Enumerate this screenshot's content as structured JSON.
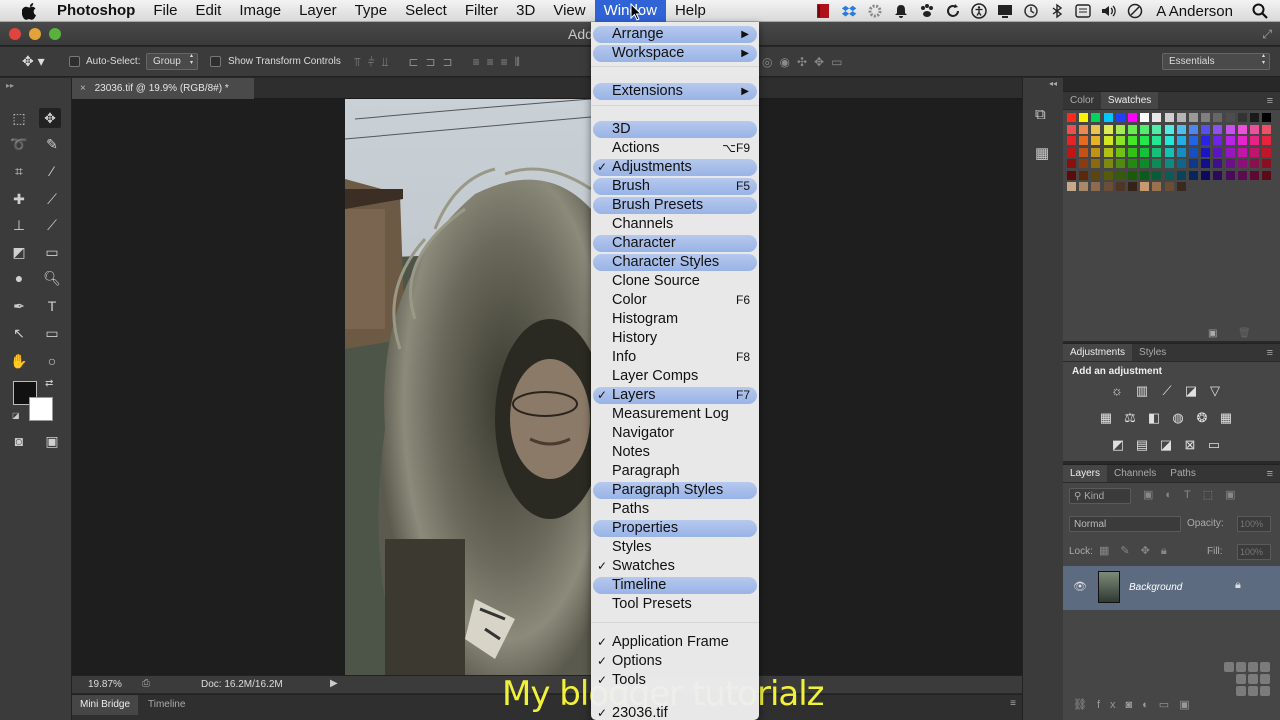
{
  "menubar": {
    "app": "Photoshop",
    "items": [
      "File",
      "Edit",
      "Image",
      "Layer",
      "Type",
      "Select",
      "Filter",
      "3D",
      "View",
      "Window",
      "Help"
    ],
    "active": "Window",
    "user": "A Anderson"
  },
  "window": {
    "title_fragment": "Add"
  },
  "options_bar": {
    "auto_select_label": "Auto-Select:",
    "auto_select_value": "Group",
    "transform_label": "Show Transform Controls",
    "workspace": "Essentials"
  },
  "document": {
    "tab": "23036.tif @ 19.9% (RGB/8#) *",
    "zoom": "19.87%",
    "doc_size": "Doc: 16.2M/16.2M"
  },
  "bottom_tabs": [
    "Mini Bridge",
    "Timeline"
  ],
  "watermark": "My blogger tutorialz",
  "panels": {
    "color_tabs": [
      "Color",
      "Swatches"
    ],
    "adjust_tabs": [
      "Adjustments",
      "Styles"
    ],
    "adjust_hint": "Add an adjustment",
    "layers_tabs": [
      "Layers",
      "Channels",
      "Paths"
    ],
    "kind_label": "Kind",
    "blend_mode": "Normal",
    "opacity_label": "Opacity:",
    "opacity_value": "100%",
    "lock_label": "Lock:",
    "fill_label": "Fill:",
    "fill_value": "100%",
    "layer_name": "Background"
  },
  "window_menu": [
    {
      "label": "Arrange",
      "submenu": true,
      "hl": true
    },
    {
      "label": "Workspace",
      "submenu": true,
      "hl": true
    },
    {
      "label": "Extensions",
      "submenu": true,
      "hl": true
    },
    {
      "label": "3D",
      "hl": true
    },
    {
      "label": "Actions",
      "shortcut": "⌥F9"
    },
    {
      "label": "Adjustments",
      "checked": true,
      "hl": true
    },
    {
      "label": "Brush",
      "shortcut": "F5",
      "hl": true
    },
    {
      "label": "Brush Presets",
      "hl": true
    },
    {
      "label": "Channels"
    },
    {
      "label": "Character",
      "hl": true
    },
    {
      "label": "Character Styles",
      "hl": true
    },
    {
      "label": "Clone Source"
    },
    {
      "label": "Color",
      "shortcut": "F6"
    },
    {
      "label": "Histogram"
    },
    {
      "label": "History"
    },
    {
      "label": "Info",
      "shortcut": "F8"
    },
    {
      "label": "Layer Comps"
    },
    {
      "label": "Layers",
      "checked": true,
      "shortcut": "F7",
      "hl": true
    },
    {
      "label": "Measurement Log"
    },
    {
      "label": "Navigator"
    },
    {
      "label": "Notes"
    },
    {
      "label": "Paragraph"
    },
    {
      "label": "Paragraph Styles",
      "hl": true
    },
    {
      "label": "Paths"
    },
    {
      "label": "Properties",
      "hl": true
    },
    {
      "label": "Styles"
    },
    {
      "label": "Swatches",
      "checked": true
    },
    {
      "label": "Timeline",
      "hl": true
    },
    {
      "label": "Tool Presets"
    },
    {
      "label": "Application Frame",
      "checked": true
    },
    {
      "label": "Options",
      "checked": true
    },
    {
      "label": "Tools",
      "checked": true
    },
    {
      "label": "23036.tif",
      "checked": true
    }
  ]
}
